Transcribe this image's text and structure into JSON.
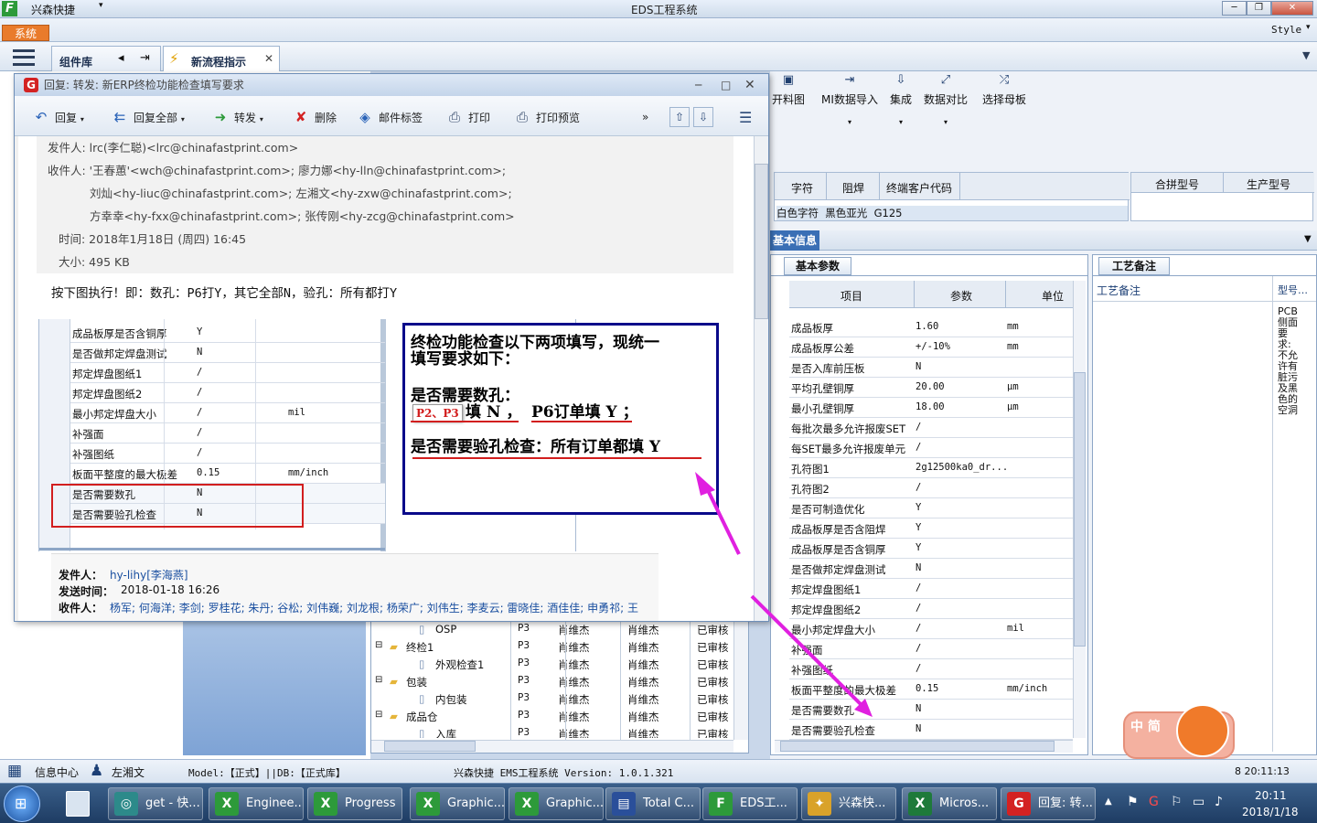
{
  "app": {
    "quick_menu": "兴森快捷",
    "window_title": "EDS工程系统",
    "style_label": "Style",
    "system_button": "系统",
    "tabs": [
      "组件库",
      "新流程指示"
    ]
  },
  "mail": {
    "title": "回复: 转发: 新ERP终检功能检查填写要求",
    "toolbar": [
      "回复",
      "回复全部",
      "转发",
      "删除",
      "邮件标签",
      "打印",
      "打印预览"
    ],
    "more": "»",
    "from": "发件人: lrc(李仁聪)<lrc@chinafastprint.com>",
    "to_1": "收件人: '王春蕙'<wch@chinafastprint.com>; 廖力娜<hy-lln@chinafastprint.com>;",
    "to_2": "刘灿<hy-liuc@chinafastprint.com>; 左湘文<hy-zxw@chinafastprint.com>;",
    "to_3": "方幸幸<hy-fxx@chinafastprint.com>; 张传刚<hy-zcg@chinafastprint.com>",
    "time": "时间: 2018年1月18日 (周四) 16:45",
    "size": "大小: 495 KB",
    "body": "按下图执行！即：数孔：P6打Y，其它全部N，验孔：所有都打Y",
    "table_rows": [
      {
        "name": "成品板厚是否含铜厚",
        "val": "Y",
        "unit": ""
      },
      {
        "name": "是否做邦定焊盘测试",
        "val": "N",
        "unit": ""
      },
      {
        "name": "邦定焊盘图纸1",
        "val": "/",
        "unit": ""
      },
      {
        "name": "邦定焊盘图纸2",
        "val": "/",
        "unit": ""
      },
      {
        "name": "最小邦定焊盘大小",
        "val": "/",
        "unit": "mil"
      },
      {
        "name": "补强面",
        "val": "/",
        "unit": ""
      },
      {
        "name": "补强图纸",
        "val": "/",
        "unit": ""
      },
      {
        "name": "板面平整度的最大极差",
        "val": "0.15",
        "unit": "mm/inch"
      },
      {
        "name": "是否需要数孔",
        "val": "N",
        "unit": ""
      },
      {
        "name": "是否需要验孔检查",
        "val": "N",
        "unit": ""
      }
    ],
    "callout": {
      "line1": "终检功能检查以下两项填写，现统一",
      "line2": "填写要求如下：",
      "line3": "是否需要数孔：",
      "tag": "P2、P3",
      "line4a": "填 N ，",
      "line4b": "P6订单填 Y ；",
      "line5": "是否需要验孔检查：所有订单都填 Y"
    },
    "footer": {
      "sender_label": "发件人：",
      "sender": "hy-lihy[李海燕]",
      "sent_label": "发送时间：",
      "sent": "2018-01-18 16:26",
      "to_label": "收件人：",
      "to": "杨军; 何海洋; 李剑; 罗桂花; 朱丹; 谷松; 刘伟巍; 刘龙根; 杨荣广; 刘伟生; 李麦云; 雷晓佳; 酒佳佳; 申勇祁; 王"
    }
  },
  "ribbon": {
    "items": [
      "开料图",
      "MI数据导入",
      "集成",
      "数据对比",
      "选择母板"
    ]
  },
  "spec_header": [
    "字符",
    "阻焊",
    "终端客户代码"
  ],
  "spec_values": "白色字符  黑色亚光  G125",
  "model_header": [
    "合拼型号",
    "生产型号"
  ],
  "basic_info_tab": "基本信息",
  "basic_param_tab": "基本参数",
  "process_note_tab": "工艺备注",
  "process_note_label": "工艺备注",
  "model_col": "型号…",
  "model_note": "PCB侧面要求:不允许有脏污及黑色的空洞",
  "param_header": [
    "项目",
    "参数",
    "单位"
  ],
  "params": [
    {
      "name": "成品板厚",
      "val": "1.60",
      "unit": "mm"
    },
    {
      "name": "成品板厚公差",
      "val": "+/-10%",
      "unit": "mm"
    },
    {
      "name": "是否入库前压板",
      "val": "N",
      "unit": ""
    },
    {
      "name": "平均孔壁铜厚",
      "val": "20.00",
      "unit": "μm"
    },
    {
      "name": "最小孔壁铜厚",
      "val": "18.00",
      "unit": "μm"
    },
    {
      "name": "每批次最多允许报废SET",
      "val": "/",
      "unit": ""
    },
    {
      "name": "每SET最多允许报废单元",
      "val": "/",
      "unit": ""
    },
    {
      "name": "孔符图1",
      "val": "2g12500ka0_dr...",
      "unit": ""
    },
    {
      "name": "孔符图2",
      "val": "/",
      "unit": ""
    },
    {
      "name": "是否可制造优化",
      "val": "Y",
      "unit": ""
    },
    {
      "name": "成品板厚是否含阻焊",
      "val": "Y",
      "unit": ""
    },
    {
      "name": "成品板厚是否含铜厚",
      "val": "Y",
      "unit": ""
    },
    {
      "name": "是否做邦定焊盘测试",
      "val": "N",
      "unit": ""
    },
    {
      "name": "邦定焊盘图纸1",
      "val": "/",
      "unit": ""
    },
    {
      "name": "邦定焊盘图纸2",
      "val": "/",
      "unit": ""
    },
    {
      "name": "最小邦定焊盘大小",
      "val": "/",
      "unit": "mil"
    },
    {
      "name": "补强面",
      "val": "/",
      "unit": ""
    },
    {
      "name": "补强图纸",
      "val": "/",
      "unit": ""
    },
    {
      "name": "板面平整度的最大极差",
      "val": "0.15",
      "unit": "mm/inch"
    },
    {
      "name": "是否需要数孔",
      "val": "N",
      "unit": ""
    },
    {
      "name": "是否需要验孔检查",
      "val": "N",
      "unit": ""
    }
  ],
  "tree": [
    {
      "name": "OSP",
      "p": "P3",
      "a": "肖维杰",
      "b": "肖维杰",
      "s": "已审核",
      "lvl": 2,
      "folder": false
    },
    {
      "name": "终检1",
      "p": "P3",
      "a": "肖维杰",
      "b": "肖维杰",
      "s": "已审核",
      "lvl": 1,
      "folder": true
    },
    {
      "name": "外观检查1",
      "p": "P3",
      "a": "肖维杰",
      "b": "肖维杰",
      "s": "已审核",
      "lvl": 2,
      "folder": false
    },
    {
      "name": "包装",
      "p": "P3",
      "a": "肖维杰",
      "b": "肖维杰",
      "s": "已审核",
      "lvl": 1,
      "folder": true
    },
    {
      "name": "内包装",
      "p": "P3",
      "a": "肖维杰",
      "b": "肖维杰",
      "s": "已审核",
      "lvl": 2,
      "folder": false
    },
    {
      "name": "成品仓",
      "p": "P3",
      "a": "肖维杰",
      "b": "肖维杰",
      "s": "已审核",
      "lvl": 1,
      "folder": true
    },
    {
      "name": "入库",
      "p": "P3",
      "a": "肖维杰",
      "b": "肖维杰",
      "s": "已审核",
      "lvl": 2,
      "folder": false
    }
  ],
  "status": {
    "msg_center": "信息中心",
    "user": "左湘文",
    "model": "Model:【正式】||DB:【正式库】",
    "system": "兴森快捷 EMS工程系统 Version: 1.0.1.321",
    "clock": "8 20:11:13"
  },
  "mascot_text": "中 简",
  "taskbar": {
    "items": [
      "get - 快...",
      "Enginee...",
      "Progress",
      "Graphic...",
      "Graphic...",
      "Total C...",
      "EDS工...",
      "兴森快...",
      "Micros...",
      "回复: 转..."
    ],
    "time": "20:11",
    "date": "2018/1/18"
  },
  "colors": {
    "accent": "#e97b2b",
    "annotation_red": "#d21e1e",
    "annotation_arrow": "#e020e0",
    "callout_border": "#0a0a8a"
  }
}
